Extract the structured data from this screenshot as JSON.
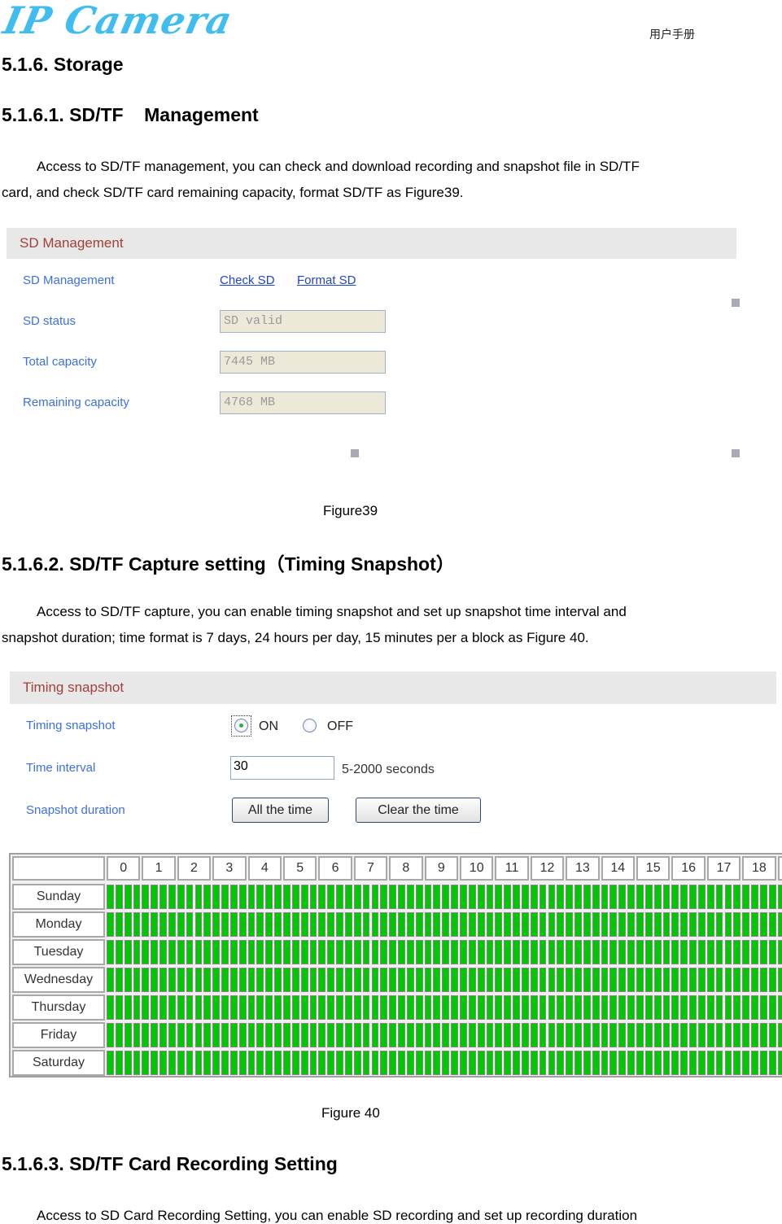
{
  "header": {
    "logo_text": "IP Camera",
    "manual_label": "用户手册"
  },
  "section": {
    "title": "5.1.6.  Storage"
  },
  "sd_management": {
    "heading": "5.1.6.1. SD/TF    Management",
    "paragraph_line1": "Access to SD/TF management, you can check and download recording and snapshot file in SD/TF",
    "paragraph_line2": "card, and check SD/TF card remaining capacity, format SD/TF as Figure39.",
    "figure": {
      "panel_title": "SD Management",
      "rows": [
        {
          "label": "SD Management"
        },
        {
          "label": "SD status",
          "value": "SD valid"
        },
        {
          "label": "Total capacity",
          "value": "7445 MB"
        },
        {
          "label": "Remaining capacity",
          "value": "4768 MB"
        }
      ],
      "check_sd_link": "Check SD",
      "format_sd_link": "Format SD",
      "marker_color": "#a8aab4"
    },
    "caption": "Figure39"
  },
  "capture_setting": {
    "heading": "5.1.6.2. SD/TF Capture setting（Timing Snapshot）",
    "paragraph_line1": "Access to SD/TF capture, you can enable timing snapshot and set up snapshot time interval and",
    "paragraph_line2": "snapshot duration; time format is 7 days, 24 hours per day, 15 minutes per a block as Figure 40.",
    "figure": {
      "panel_title": "Timing snapshot",
      "timing_label": "Timing snapshot",
      "on_label": "ON",
      "off_label": "OFF",
      "selected": "ON",
      "interval_label": "Time interval",
      "interval_value": "30",
      "interval_hint": "5-2000 seconds",
      "duration_label": "Snapshot duration",
      "all_time_button": "All the time",
      "clear_time_button": "Clear the time",
      "schedule": {
        "hours_visible": [
          "0",
          "1",
          "2",
          "3",
          "4",
          "5",
          "6",
          "7",
          "8",
          "9",
          "10",
          "11",
          "12",
          "13",
          "14",
          "15",
          "16",
          "17",
          "18"
        ],
        "days": [
          "Sunday",
          "Monday",
          "Tuesday",
          "Wednesday",
          "Thursday",
          "Friday",
          "Saturday"
        ],
        "blocks_per_hour": 4,
        "all_selected": true,
        "selected_color": "#00c800"
      }
    },
    "caption": "Figure 40"
  },
  "recording_setting": {
    "heading": "5.1.6.3. SD/TF Card Recording Setting",
    "paragraph_line1": "Access to SD Card Recording Setting, you can enable SD recording and set up recording duration"
  }
}
